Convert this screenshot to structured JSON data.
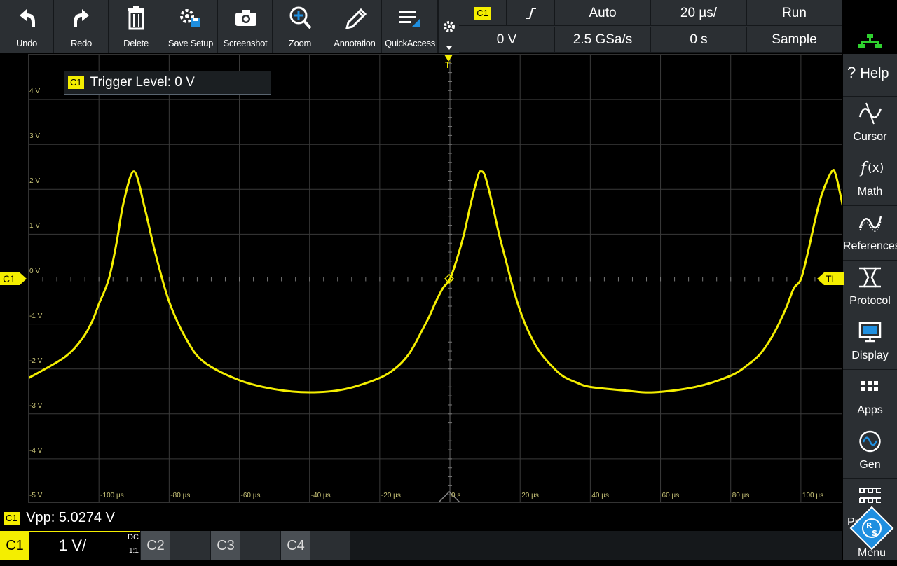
{
  "toolbar": {
    "buttons": [
      {
        "label": "Undo",
        "icon": "undo-icon"
      },
      {
        "label": "Redo",
        "icon": "redo-icon"
      },
      {
        "label": "Delete",
        "icon": "trash-icon"
      },
      {
        "label": "Save Setup",
        "icon": "save-setup-icon"
      },
      {
        "label": "Screenshot",
        "icon": "camera-icon"
      },
      {
        "label": "Zoom",
        "icon": "zoom-icon"
      },
      {
        "label": "Annotation",
        "icon": "pen-icon"
      },
      {
        "label": "QuickAccess",
        "icon": "quickaccess-icon"
      }
    ]
  },
  "status": {
    "trigger_source": "C1",
    "trigger_mode": "Auto",
    "timebase": "20 µs/",
    "run_state": "Run",
    "trigger_level": "0 V",
    "sample_rate": "2.5 GSa/s",
    "horizontal_position": "0 s",
    "acquisition_mode": "Sample"
  },
  "right_menu": [
    {
      "label": "Help",
      "icon": "help-icon",
      "prefix": "?"
    },
    {
      "label": "Cursor",
      "icon": "cursor-icon"
    },
    {
      "label": "Math",
      "icon": "math-icon"
    },
    {
      "label": "References",
      "icon": "references-icon"
    },
    {
      "label": "Protocol",
      "icon": "protocol-icon"
    },
    {
      "label": "Display",
      "icon": "display-icon"
    },
    {
      "label": "Apps",
      "icon": "apps-icon"
    },
    {
      "label": "Gen",
      "icon": "generator-icon"
    },
    {
      "label": "Pr",
      "icon": "probe-icon"
    },
    {
      "label": "Menu",
      "icon": "rs-logo-icon"
    }
  ],
  "trigger_info": {
    "channel": "C1",
    "text": "Trigger Level: 0 V"
  },
  "markers": {
    "channel_left": "C1",
    "trigger_level_right": "TL",
    "trigger_top": "T"
  },
  "measurement": {
    "channel": "C1",
    "text": "Vpp: 5.0274 V"
  },
  "channels": {
    "c1": {
      "label": "C1",
      "scale": "1 V/",
      "coupling": "DC",
      "probe": "1:1"
    },
    "c2": {
      "label": "C2"
    },
    "c3": {
      "label": "C3"
    },
    "c4": {
      "label": "C4"
    }
  },
  "colors": {
    "trace": "#f4ee00",
    "panel": "#2b2f33",
    "grid": "#3a3a3a",
    "axis_text": "#c9c478",
    "accent_blue": "#1f8fe0",
    "network_green": "#2fd12f"
  },
  "chart_data": {
    "type": "line",
    "y_tick_labels": [
      "4 V",
      "3 V",
      "2 V",
      "1 V",
      "0 V",
      "-1 V",
      "-2 V",
      "-3 V",
      "-4 V",
      "-5 V"
    ],
    "x_tick_labels": [
      "-100 µs",
      "-80 µs",
      "-60 µs",
      "-40 µs",
      "-20 µs",
      "0 s",
      "20 µs",
      "40 µs",
      "60 µs",
      "80 µs",
      "100 µs"
    ],
    "xlim": [
      -120,
      112
    ],
    "ylim": [
      -5,
      5
    ],
    "series": [
      {
        "x": [
          -120,
          -110,
          -105,
          -102,
          -100,
          -97.2,
          -95,
          -93,
          -90,
          -87,
          -84,
          -80,
          -75,
          -70,
          -60,
          -50,
          -40,
          -30,
          -20,
          -15,
          -12,
          -10,
          -8,
          -6,
          -4,
          -2,
          0,
          2,
          4,
          6,
          8,
          8.8,
          10,
          12,
          14,
          16,
          18,
          20,
          22,
          25,
          28,
          32,
          36,
          40,
          50,
          58,
          70,
          80,
          85,
          88,
          90,
          92,
          94,
          96,
          98,
          100,
          102,
          104,
          106,
          108.8,
          110,
          112
        ],
        "y": [
          -2.2,
          -1.75,
          -1.35,
          -0.95,
          -0.55,
          0.0,
          0.8,
          1.7,
          2.4,
          1.6,
          0.6,
          -0.5,
          -1.35,
          -1.85,
          -2.25,
          -2.45,
          -2.52,
          -2.45,
          -2.2,
          -1.95,
          -1.7,
          -1.45,
          -1.15,
          -0.85,
          -0.5,
          -0.2,
          0.0,
          0.45,
          1.0,
          1.7,
          2.3,
          2.4,
          2.3,
          1.7,
          1.0,
          0.4,
          -0.2,
          -0.7,
          -1.1,
          -1.55,
          -1.85,
          -2.15,
          -2.3,
          -2.4,
          -2.48,
          -2.52,
          -2.4,
          -2.15,
          -1.9,
          -1.7,
          -1.5,
          -1.25,
          -0.95,
          -0.6,
          -0.2,
          0.0,
          0.6,
          1.3,
          1.9,
          2.4,
          2.3,
          1.6
        ]
      }
    ]
  }
}
